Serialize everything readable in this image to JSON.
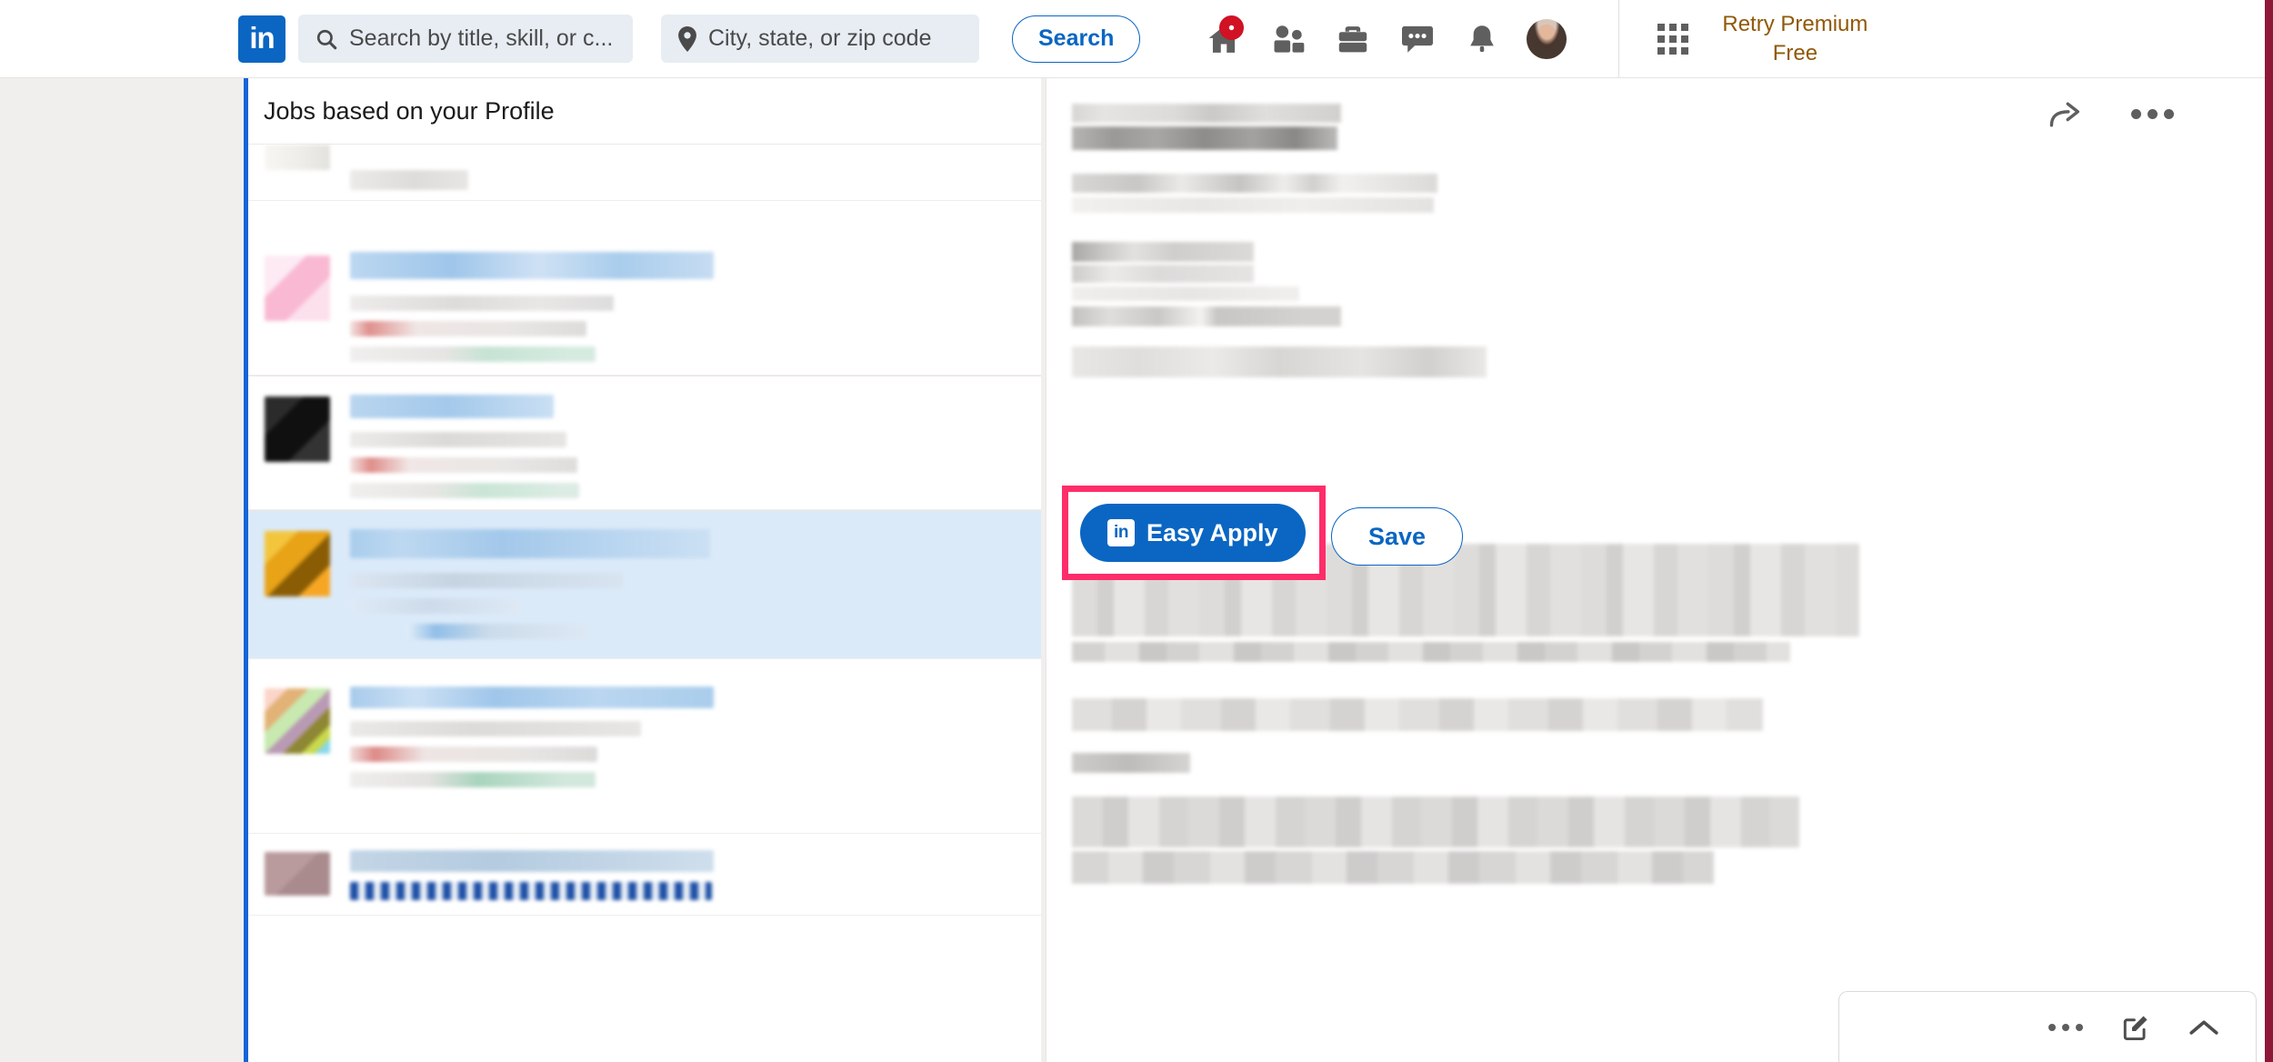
{
  "header": {
    "logo_text": "in",
    "search": {
      "keywords_placeholder": "Search by title, skill, or c...",
      "location_placeholder": "City, state, or zip code",
      "search_button": "Search",
      "search_icon": "search-icon",
      "location_icon": "map-pin-icon"
    },
    "nav": [
      {
        "name": "home",
        "icon": "home-icon",
        "badge": true
      },
      {
        "name": "my-network",
        "icon": "people-icon",
        "badge": false
      },
      {
        "name": "jobs",
        "icon": "briefcase-icon",
        "badge": false
      },
      {
        "name": "messaging",
        "icon": "message-bubble-icon",
        "badge": false
      },
      {
        "name": "notifications",
        "icon": "bell-icon",
        "badge": false
      },
      {
        "name": "me",
        "icon": "avatar-icon",
        "badge": false
      }
    ],
    "premium": {
      "grid_icon": "apps-grid-icon",
      "label_line1": "Retry Premium",
      "label_line2": "Free",
      "color": "#915907"
    }
  },
  "jobs_panel": {
    "title": "Jobs based on your Profile",
    "accent_color": "#1565d8",
    "selected_row_color": "#dbeaf9",
    "items": [
      {
        "id": 1,
        "selected": false,
        "logo_colors": [
          "#f8f6f2",
          "#efeeea",
          "#e6e5e1",
          "#dcdbd7"
        ]
      },
      {
        "id": 2,
        "selected": false,
        "logo_colors": [
          "#fde4ee",
          "#f9b9d2",
          "#fbd3e2",
          "#fdeaf3"
        ]
      },
      {
        "id": 3,
        "selected": false,
        "logo_colors": [
          "#2e2e2e",
          "#141414",
          "#3a3a3a",
          "#1f1f1f"
        ]
      },
      {
        "id": 4,
        "selected": true,
        "logo_colors": [
          "#f2c53d",
          "#e8a317",
          "#c47a0a",
          "#f6a623"
        ]
      },
      {
        "id": 5,
        "selected": false,
        "logo_colors": [
          "#fbd5c8",
          "#b8b04a",
          "#8ad7e8",
          "#c9d94c"
        ]
      },
      {
        "id": 6,
        "selected": false,
        "logo_colors": [
          "#b99a9d",
          "#a98b8e",
          "#c5a8ab",
          "#b29497"
        ]
      }
    ]
  },
  "detail_panel": {
    "share_icon": "share-arrow-icon",
    "more_icon": "more-options-icon",
    "cta": {
      "easy_apply_label": "Easy Apply",
      "easy_apply_icon": "linkedin-in-icon",
      "easy_apply_color": "#0a66c2",
      "save_label": "Save",
      "highlight_color": "#ff2d6a"
    }
  },
  "messaging_overlay": {
    "more_icon": "more-options-icon",
    "compose_icon": "compose-pencil-icon",
    "expand_icon": "chevron-up-icon"
  },
  "colors": {
    "page_background": "#f1efed",
    "panel_background": "#ffffff",
    "brand_blue": "#0a66c2",
    "badge_red": "#d11124",
    "edge_stripe": "#8e1838"
  }
}
